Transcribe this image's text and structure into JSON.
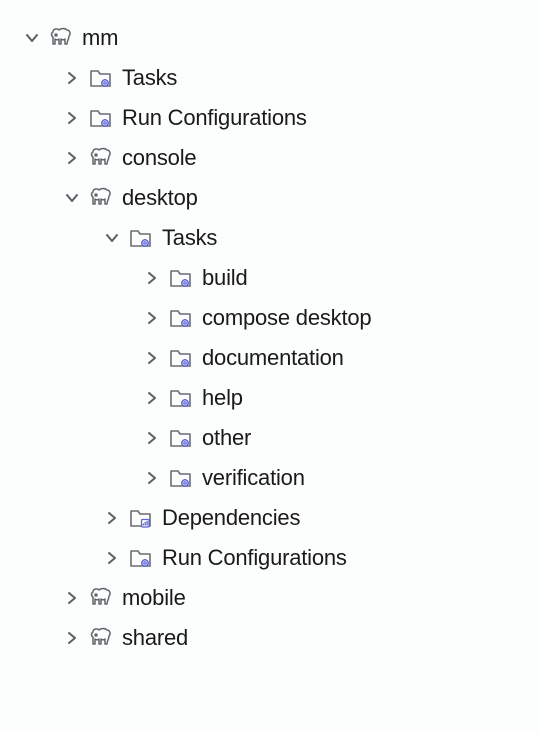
{
  "tree": {
    "root": {
      "label": "mm",
      "children": {
        "tasks": {
          "label": "Tasks"
        },
        "runConfigs": {
          "label": "Run Configurations"
        },
        "console": {
          "label": "console"
        },
        "desktop": {
          "label": "desktop",
          "children": {
            "tasks": {
              "label": "Tasks",
              "children": {
                "build": {
                  "label": "build"
                },
                "composeDesktop": {
                  "label": "compose desktop"
                },
                "documentation": {
                  "label": "documentation"
                },
                "help": {
                  "label": "help"
                },
                "other": {
                  "label": "other"
                },
                "verification": {
                  "label": "verification"
                }
              }
            },
            "dependencies": {
              "label": "Dependencies"
            },
            "runConfigs": {
              "label": "Run Configurations"
            }
          }
        },
        "mobile": {
          "label": "mobile"
        },
        "shared": {
          "label": "shared"
        }
      }
    }
  }
}
